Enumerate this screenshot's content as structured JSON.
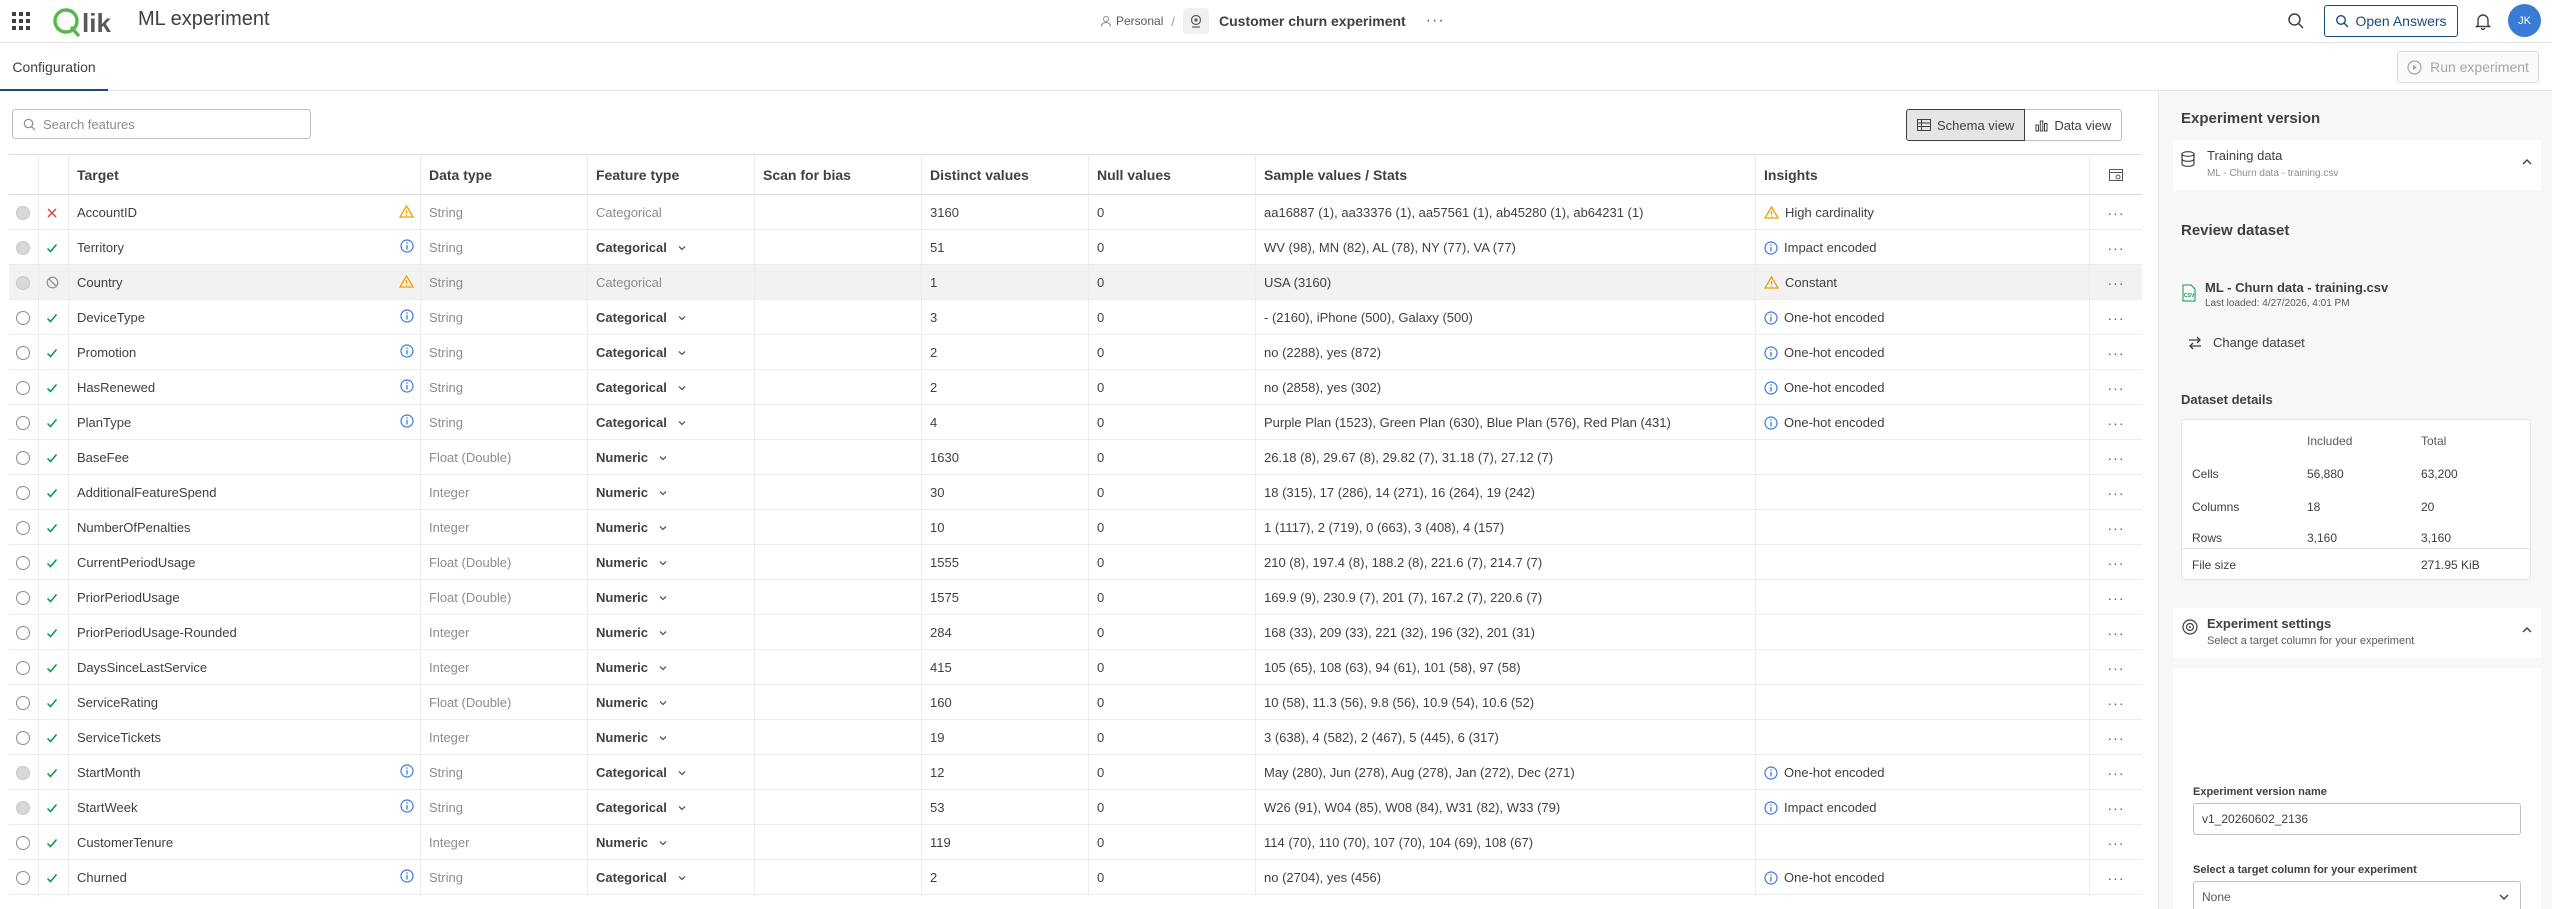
{
  "header": {
    "app_title": "ML experiment",
    "breadcrumb_personal": "Personal",
    "breadcrumb_separator": "/",
    "breadcrumb_experiment": "Customer churn experiment",
    "more": "···",
    "open_answers": "Open Answers",
    "avatar_initials": "JK",
    "logo_text": "Qlik",
    "logo_color": "#54b948"
  },
  "tabs": {
    "configuration": "Configuration"
  },
  "toolbar": {
    "run_label": "Run experiment",
    "search_placeholder": "Search features",
    "schema_view": "Schema view",
    "data_view": "Data view"
  },
  "table": {
    "headers": [
      "Target",
      "Data type",
      "Feature type",
      "Scan for bias",
      "Distinct values",
      "Null values",
      "Sample values / Stats",
      "Insights"
    ],
    "rows": [
      {
        "selector": "disabled",
        "status": "excluded",
        "name": "AccountID",
        "info": "warning",
        "data_type": "String",
        "feature_type": "Categorical",
        "ftype_muted": true,
        "distinct": "3160",
        "nulls": "0",
        "sample": "aa16887 (1), aa33376 (1), aa57561 (1), ab45280 (1), ab64231 (1)",
        "insight_icon": "warning",
        "insight": "High cardinality"
      },
      {
        "selector": "disabled",
        "status": "included",
        "name": "Territory",
        "info": "info",
        "data_type": "String",
        "feature_type": "Categorical",
        "ftype_muted": false,
        "distinct": "51",
        "nulls": "0",
        "sample": "WV (98), MN (82), AL (78), NY (77), VA (77)",
        "insight_icon": "info",
        "insight": "Impact encoded"
      },
      {
        "selector": "disabled",
        "status": "blocked",
        "name": "Country",
        "info": "warning",
        "data_type": "String",
        "feature_type": "Categorical",
        "ftype_muted": true,
        "distinct": "1",
        "nulls": "0",
        "sample": "USA (3160)",
        "insight_icon": "warning",
        "insight": "Constant",
        "row_disabled": true
      },
      {
        "selector": "enabled",
        "status": "included",
        "name": "DeviceType",
        "info": "info",
        "data_type": "String",
        "feature_type": "Categorical",
        "ftype_muted": false,
        "distinct": "3",
        "nulls": "0",
        "sample": "- (2160), iPhone (500), Galaxy (500)",
        "insight_icon": "info",
        "insight": "One-hot encoded"
      },
      {
        "selector": "enabled",
        "status": "included",
        "name": "Promotion",
        "info": "info",
        "data_type": "String",
        "feature_type": "Categorical",
        "ftype_muted": false,
        "distinct": "2",
        "nulls": "0",
        "sample": "no (2288), yes (872)",
        "insight_icon": "info",
        "insight": "One-hot encoded"
      },
      {
        "selector": "enabled",
        "status": "included",
        "name": "HasRenewed",
        "info": "info",
        "data_type": "String",
        "feature_type": "Categorical",
        "ftype_muted": false,
        "distinct": "2",
        "nulls": "0",
        "sample": "no (2858), yes (302)",
        "insight_icon": "info",
        "insight": "One-hot encoded"
      },
      {
        "selector": "enabled",
        "status": "included",
        "name": "PlanType",
        "info": "info",
        "data_type": "String",
        "feature_type": "Categorical",
        "ftype_muted": false,
        "distinct": "4",
        "nulls": "0",
        "sample": "Purple Plan (1523), Green Plan (630), Blue Plan (576), Red Plan (431)",
        "insight_icon": "info",
        "insight": "One-hot encoded"
      },
      {
        "selector": "enabled",
        "status": "included",
        "name": "BaseFee",
        "info": "",
        "data_type": "Float (Double)",
        "feature_type": "Numeric",
        "ftype_muted": false,
        "distinct": "1630",
        "nulls": "0",
        "sample": "26.18 (8), 29.67 (8), 29.82 (7), 31.18 (7), 27.12 (7)",
        "insight_icon": "",
        "insight": ""
      },
      {
        "selector": "enabled",
        "status": "included",
        "name": "AdditionalFeatureSpend",
        "info": "",
        "data_type": "Integer",
        "feature_type": "Numeric",
        "ftype_muted": false,
        "distinct": "30",
        "nulls": "0",
        "sample": "18 (315), 17 (286), 14 (271), 16 (264), 19 (242)",
        "insight_icon": "",
        "insight": ""
      },
      {
        "selector": "enabled",
        "status": "included",
        "name": "NumberOfPenalties",
        "info": "",
        "data_type": "Integer",
        "feature_type": "Numeric",
        "ftype_muted": false,
        "distinct": "10",
        "nulls": "0",
        "sample": "1 (1117), 2 (719), 0 (663), 3 (408), 4 (157)",
        "insight_icon": "",
        "insight": ""
      },
      {
        "selector": "enabled",
        "status": "included",
        "name": "CurrentPeriodUsage",
        "info": "",
        "data_type": "Float (Double)",
        "feature_type": "Numeric",
        "ftype_muted": false,
        "distinct": "1555",
        "nulls": "0",
        "sample": "210 (8), 197.4 (8), 188.2 (8), 221.6 (7), 214.7 (7)",
        "insight_icon": "",
        "insight": ""
      },
      {
        "selector": "enabled",
        "status": "included",
        "name": "PriorPeriodUsage",
        "info": "",
        "data_type": "Float (Double)",
        "feature_type": "Numeric",
        "ftype_muted": false,
        "distinct": "1575",
        "nulls": "0",
        "sample": "169.9 (9), 230.9 (7), 201 (7), 167.2 (7), 220.6 (7)",
        "insight_icon": "",
        "insight": ""
      },
      {
        "selector": "enabled",
        "status": "included",
        "name": "PriorPeriodUsage-Rounded",
        "info": "",
        "data_type": "Integer",
        "feature_type": "Numeric",
        "ftype_muted": false,
        "distinct": "284",
        "nulls": "0",
        "sample": "168 (33), 209 (33), 221 (32), 196 (32), 201 (31)",
        "insight_icon": "",
        "insight": ""
      },
      {
        "selector": "enabled",
        "status": "included",
        "name": "DaysSinceLastService",
        "info": "",
        "data_type": "Integer",
        "feature_type": "Numeric",
        "ftype_muted": false,
        "distinct": "415",
        "nulls": "0",
        "sample": "105 (65), 108 (63), 94 (61), 101 (58), 97 (58)",
        "insight_icon": "",
        "insight": ""
      },
      {
        "selector": "enabled",
        "status": "included",
        "name": "ServiceRating",
        "info": "",
        "data_type": "Float (Double)",
        "feature_type": "Numeric",
        "ftype_muted": false,
        "distinct": "160",
        "nulls": "0",
        "sample": "10 (58), 11.3 (56), 9.8 (56), 10.9 (54), 10.6 (52)",
        "insight_icon": "",
        "insight": ""
      },
      {
        "selector": "enabled",
        "status": "included",
        "name": "ServiceTickets",
        "info": "",
        "data_type": "Integer",
        "feature_type": "Numeric",
        "ftype_muted": false,
        "distinct": "19",
        "nulls": "0",
        "sample": "3 (638), 4 (582), 2 (467), 5 (445), 6 (317)",
        "insight_icon": "",
        "insight": ""
      },
      {
        "selector": "disabled",
        "status": "included",
        "name": "StartMonth",
        "info": "info",
        "data_type": "String",
        "feature_type": "Categorical",
        "ftype_muted": false,
        "distinct": "12",
        "nulls": "0",
        "sample": "May (280), Jun (278), Aug (278), Jan (272), Dec (271)",
        "insight_icon": "info",
        "insight": "One-hot encoded"
      },
      {
        "selector": "disabled",
        "status": "included",
        "name": "StartWeek",
        "info": "info",
        "data_type": "String",
        "feature_type": "Categorical",
        "ftype_muted": false,
        "distinct": "53",
        "nulls": "0",
        "sample": "W26 (91), W04 (85), W08 (84), W31 (82), W33 (79)",
        "insight_icon": "info",
        "insight": "Impact encoded"
      },
      {
        "selector": "enabled",
        "status": "included",
        "name": "CustomerTenure",
        "info": "",
        "data_type": "Integer",
        "feature_type": "Numeric",
        "ftype_muted": false,
        "distinct": "119",
        "nulls": "0",
        "sample": "114 (70), 110 (70), 107 (70), 104 (69), 108 (67)",
        "insight_icon": "",
        "insight": ""
      },
      {
        "selector": "enabled",
        "status": "included",
        "name": "Churned",
        "info": "info",
        "data_type": "String",
        "feature_type": "Categorical",
        "ftype_muted": false,
        "distinct": "2",
        "nulls": "0",
        "sample": "no (2704), yes (456)",
        "insight_icon": "info",
        "insight": "One-hot encoded"
      }
    ]
  },
  "panel": {
    "title": "Experiment version",
    "training_title": "Training data",
    "training_sub": "ML - Churn data - training.csv",
    "review_title": "Review dataset",
    "dataset_name": "ML - Churn data - training.csv",
    "dataset_loaded": "Last loaded: 4/27/2026, 4:01 PM",
    "change_dataset": "Change dataset",
    "details_title": "Dataset details",
    "col_included": "Included",
    "col_total": "Total",
    "details": [
      {
        "label": "Cells",
        "included": "56,880",
        "total": "63,200"
      },
      {
        "label": "Columns",
        "included": "18",
        "total": "20"
      },
      {
        "label": "Rows",
        "included": "3,160",
        "total": "3,160"
      }
    ],
    "file_size_label": "File size",
    "file_size": "271.95 KiB",
    "settings_title": "Experiment settings",
    "settings_sub": "Select a target column for your experiment",
    "version_name_label": "Experiment version name",
    "version_name_value": "v1_20260602_2136",
    "target_label": "Select a target column for your experiment",
    "target_value": "None"
  },
  "colors": {
    "included_check": "#009845",
    "excluded_x": "#dc423a",
    "warning": "#f0a000",
    "info": "#3a7bd5",
    "accent": "#1c4b78"
  }
}
